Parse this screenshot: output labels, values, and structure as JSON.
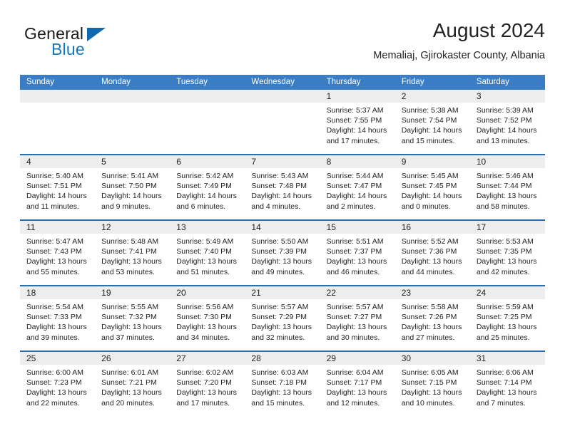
{
  "brand": {
    "name_part1": "General",
    "name_part2": "Blue",
    "triangle_icon": "triangle-icon",
    "accent_color": "#1277bf",
    "triangle_color": "#1069ae"
  },
  "header": {
    "title": "August 2024",
    "subtitle": "Memaliaj, Gjirokaster County, Albania"
  },
  "calendar": {
    "header_bg": "#3b7dc4",
    "row_divider_color": "#2e6da9",
    "datebar_bg": "#ededed",
    "weekdays": [
      "Sunday",
      "Monday",
      "Tuesday",
      "Wednesday",
      "Thursday",
      "Friday",
      "Saturday"
    ],
    "weeks": [
      [
        {
          "day": "",
          "sunrise": "",
          "sunset": "",
          "daylight_line1": "",
          "daylight_line2": ""
        },
        {
          "day": "",
          "sunrise": "",
          "sunset": "",
          "daylight_line1": "",
          "daylight_line2": ""
        },
        {
          "day": "",
          "sunrise": "",
          "sunset": "",
          "daylight_line1": "",
          "daylight_line2": ""
        },
        {
          "day": "",
          "sunrise": "",
          "sunset": "",
          "daylight_line1": "",
          "daylight_line2": ""
        },
        {
          "day": "1",
          "sunrise": "Sunrise: 5:37 AM",
          "sunset": "Sunset: 7:55 PM",
          "daylight_line1": "Daylight: 14 hours",
          "daylight_line2": "and 17 minutes."
        },
        {
          "day": "2",
          "sunrise": "Sunrise: 5:38 AM",
          "sunset": "Sunset: 7:54 PM",
          "daylight_line1": "Daylight: 14 hours",
          "daylight_line2": "and 15 minutes."
        },
        {
          "day": "3",
          "sunrise": "Sunrise: 5:39 AM",
          "sunset": "Sunset: 7:52 PM",
          "daylight_line1": "Daylight: 14 hours",
          "daylight_line2": "and 13 minutes."
        }
      ],
      [
        {
          "day": "4",
          "sunrise": "Sunrise: 5:40 AM",
          "sunset": "Sunset: 7:51 PM",
          "daylight_line1": "Daylight: 14 hours",
          "daylight_line2": "and 11 minutes."
        },
        {
          "day": "5",
          "sunrise": "Sunrise: 5:41 AM",
          "sunset": "Sunset: 7:50 PM",
          "daylight_line1": "Daylight: 14 hours",
          "daylight_line2": "and 9 minutes."
        },
        {
          "day": "6",
          "sunrise": "Sunrise: 5:42 AM",
          "sunset": "Sunset: 7:49 PM",
          "daylight_line1": "Daylight: 14 hours",
          "daylight_line2": "and 6 minutes."
        },
        {
          "day": "7",
          "sunrise": "Sunrise: 5:43 AM",
          "sunset": "Sunset: 7:48 PM",
          "daylight_line1": "Daylight: 14 hours",
          "daylight_line2": "and 4 minutes."
        },
        {
          "day": "8",
          "sunrise": "Sunrise: 5:44 AM",
          "sunset": "Sunset: 7:47 PM",
          "daylight_line1": "Daylight: 14 hours",
          "daylight_line2": "and 2 minutes."
        },
        {
          "day": "9",
          "sunrise": "Sunrise: 5:45 AM",
          "sunset": "Sunset: 7:45 PM",
          "daylight_line1": "Daylight: 14 hours",
          "daylight_line2": "and 0 minutes."
        },
        {
          "day": "10",
          "sunrise": "Sunrise: 5:46 AM",
          "sunset": "Sunset: 7:44 PM",
          "daylight_line1": "Daylight: 13 hours",
          "daylight_line2": "and 58 minutes."
        }
      ],
      [
        {
          "day": "11",
          "sunrise": "Sunrise: 5:47 AM",
          "sunset": "Sunset: 7:43 PM",
          "daylight_line1": "Daylight: 13 hours",
          "daylight_line2": "and 55 minutes."
        },
        {
          "day": "12",
          "sunrise": "Sunrise: 5:48 AM",
          "sunset": "Sunset: 7:41 PM",
          "daylight_line1": "Daylight: 13 hours",
          "daylight_line2": "and 53 minutes."
        },
        {
          "day": "13",
          "sunrise": "Sunrise: 5:49 AM",
          "sunset": "Sunset: 7:40 PM",
          "daylight_line1": "Daylight: 13 hours",
          "daylight_line2": "and 51 minutes."
        },
        {
          "day": "14",
          "sunrise": "Sunrise: 5:50 AM",
          "sunset": "Sunset: 7:39 PM",
          "daylight_line1": "Daylight: 13 hours",
          "daylight_line2": "and 49 minutes."
        },
        {
          "day": "15",
          "sunrise": "Sunrise: 5:51 AM",
          "sunset": "Sunset: 7:37 PM",
          "daylight_line1": "Daylight: 13 hours",
          "daylight_line2": "and 46 minutes."
        },
        {
          "day": "16",
          "sunrise": "Sunrise: 5:52 AM",
          "sunset": "Sunset: 7:36 PM",
          "daylight_line1": "Daylight: 13 hours",
          "daylight_line2": "and 44 minutes."
        },
        {
          "day": "17",
          "sunrise": "Sunrise: 5:53 AM",
          "sunset": "Sunset: 7:35 PM",
          "daylight_line1": "Daylight: 13 hours",
          "daylight_line2": "and 42 minutes."
        }
      ],
      [
        {
          "day": "18",
          "sunrise": "Sunrise: 5:54 AM",
          "sunset": "Sunset: 7:33 PM",
          "daylight_line1": "Daylight: 13 hours",
          "daylight_line2": "and 39 minutes."
        },
        {
          "day": "19",
          "sunrise": "Sunrise: 5:55 AM",
          "sunset": "Sunset: 7:32 PM",
          "daylight_line1": "Daylight: 13 hours",
          "daylight_line2": "and 37 minutes."
        },
        {
          "day": "20",
          "sunrise": "Sunrise: 5:56 AM",
          "sunset": "Sunset: 7:30 PM",
          "daylight_line1": "Daylight: 13 hours",
          "daylight_line2": "and 34 minutes."
        },
        {
          "day": "21",
          "sunrise": "Sunrise: 5:57 AM",
          "sunset": "Sunset: 7:29 PM",
          "daylight_line1": "Daylight: 13 hours",
          "daylight_line2": "and 32 minutes."
        },
        {
          "day": "22",
          "sunrise": "Sunrise: 5:57 AM",
          "sunset": "Sunset: 7:27 PM",
          "daylight_line1": "Daylight: 13 hours",
          "daylight_line2": "and 30 minutes."
        },
        {
          "day": "23",
          "sunrise": "Sunrise: 5:58 AM",
          "sunset": "Sunset: 7:26 PM",
          "daylight_line1": "Daylight: 13 hours",
          "daylight_line2": "and 27 minutes."
        },
        {
          "day": "24",
          "sunrise": "Sunrise: 5:59 AM",
          "sunset": "Sunset: 7:25 PM",
          "daylight_line1": "Daylight: 13 hours",
          "daylight_line2": "and 25 minutes."
        }
      ],
      [
        {
          "day": "25",
          "sunrise": "Sunrise: 6:00 AM",
          "sunset": "Sunset: 7:23 PM",
          "daylight_line1": "Daylight: 13 hours",
          "daylight_line2": "and 22 minutes."
        },
        {
          "day": "26",
          "sunrise": "Sunrise: 6:01 AM",
          "sunset": "Sunset: 7:21 PM",
          "daylight_line1": "Daylight: 13 hours",
          "daylight_line2": "and 20 minutes."
        },
        {
          "day": "27",
          "sunrise": "Sunrise: 6:02 AM",
          "sunset": "Sunset: 7:20 PM",
          "daylight_line1": "Daylight: 13 hours",
          "daylight_line2": "and 17 minutes."
        },
        {
          "day": "28",
          "sunrise": "Sunrise: 6:03 AM",
          "sunset": "Sunset: 7:18 PM",
          "daylight_line1": "Daylight: 13 hours",
          "daylight_line2": "and 15 minutes."
        },
        {
          "day": "29",
          "sunrise": "Sunrise: 6:04 AM",
          "sunset": "Sunset: 7:17 PM",
          "daylight_line1": "Daylight: 13 hours",
          "daylight_line2": "and 12 minutes."
        },
        {
          "day": "30",
          "sunrise": "Sunrise: 6:05 AM",
          "sunset": "Sunset: 7:15 PM",
          "daylight_line1": "Daylight: 13 hours",
          "daylight_line2": "and 10 minutes."
        },
        {
          "day": "31",
          "sunrise": "Sunrise: 6:06 AM",
          "sunset": "Sunset: 7:14 PM",
          "daylight_line1": "Daylight: 13 hours",
          "daylight_line2": "and 7 minutes."
        }
      ]
    ]
  }
}
